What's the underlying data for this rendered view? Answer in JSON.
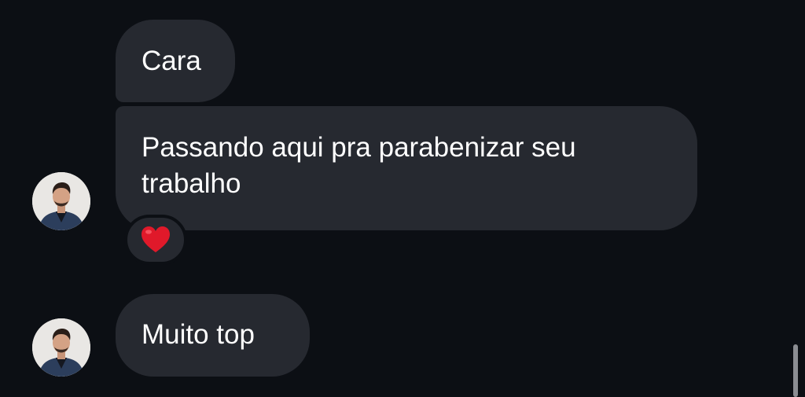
{
  "messages": [
    {
      "text": "Cara"
    },
    {
      "text": "Passando aqui pra parabenizar seu trabalho",
      "reaction": "heart-icon"
    },
    {
      "text": "Muito top"
    }
  ],
  "colors": {
    "background": "#0c0f14",
    "bubble": "#262930",
    "text": "#ffffff",
    "heart": "#e0192a"
  }
}
